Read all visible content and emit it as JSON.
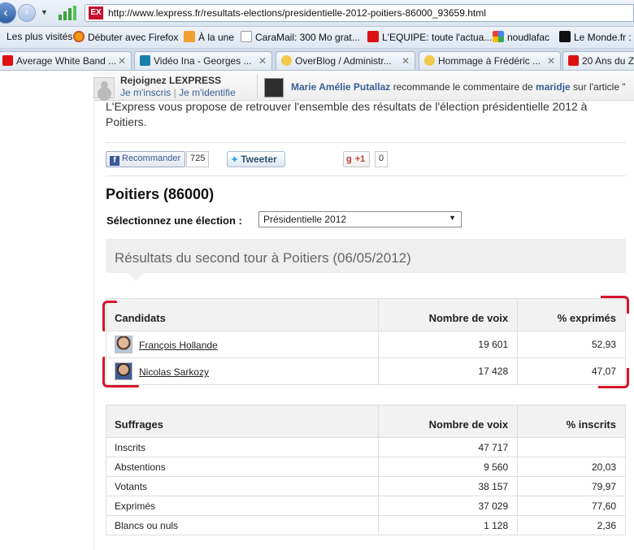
{
  "browser": {
    "url": "http://www.lexpress.fr/resultats-elections/presidentielle-2012-poitiers-86000_93659.html",
    "site_icon_text": "EX",
    "bookmarks": [
      "Les plus visités",
      "Débuter avec Firefox",
      "À la une",
      "CaraMail: 300 Mo grat...",
      "L'EQUIPE: toute l'actua...",
      "noudlafac",
      "Le Monde.fr :"
    ],
    "tabs": [
      "Average White Band ...",
      "Vidéo Ina - Georges ...",
      "OverBlog / Administr...",
      "Hommage à Frédéric ...",
      "20 Ans du Z"
    ]
  },
  "social": {
    "join_title": "Rejoignez LEXPRESS",
    "signup_link": "Je m'inscris",
    "separator": "|",
    "login_link": "Je m'identifie",
    "reco_user": "Marie Amélie Putallaz",
    "reco_mid": " recommande le commentaire de ",
    "reco_target": "maridje",
    "reco_end": " sur l'article \""
  },
  "intro": "L'Express vous propose de retrouver l'ensemble des résultats de l'élection présidentielle 2012 à Poitiers.",
  "share": {
    "facebook_label": "Recommander",
    "facebook_count": "725",
    "twitter_label": "Tweeter",
    "gplus_label": "+1",
    "gplus_count": "0"
  },
  "city_title": "Poitiers (86000)",
  "select_label": "Sélectionnez une élection :",
  "select_value": "Présidentielle 2012",
  "results_title": "Résultats du second tour à Poitiers (06/05/2012)",
  "candidates_table": {
    "headers": [
      "Candidats",
      "Nombre de voix",
      "% exprimés"
    ],
    "rows": [
      {
        "name": "François Hollande",
        "votes": "19 601",
        "pct": "52,93"
      },
      {
        "name": "Nicolas Sarkozy",
        "votes": "17 428",
        "pct": "47,07"
      }
    ]
  },
  "suffrages_table": {
    "headers": [
      "Suffrages",
      "Nombre de voix",
      "% inscrits"
    ],
    "rows": [
      {
        "label": "Inscrits",
        "votes": "47 717",
        "pct": ""
      },
      {
        "label": "Abstentions",
        "votes": "9 560",
        "pct": "20,03"
      },
      {
        "label": "Votants",
        "votes": "38 157",
        "pct": "79,97"
      },
      {
        "label": "Exprimés",
        "votes": "37 029",
        "pct": "77,60"
      },
      {
        "label": "Blancs ou nuls",
        "votes": "1 128",
        "pct": "2,36"
      }
    ]
  },
  "colors": {
    "accent_link": "#3a5f96",
    "annotation_red": "#d6152a",
    "lexpress_red": "#c8102e"
  }
}
